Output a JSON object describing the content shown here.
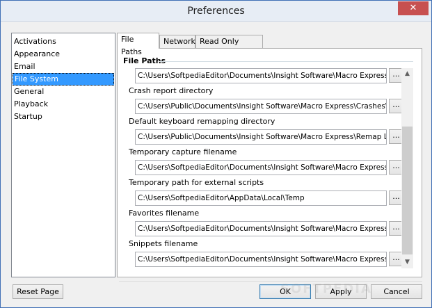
{
  "window": {
    "title": "Preferences",
    "close_glyph": "✕"
  },
  "categories": [
    {
      "label": "Activations",
      "selected": false
    },
    {
      "label": "Appearance",
      "selected": false
    },
    {
      "label": "Email",
      "selected": false
    },
    {
      "label": "File System",
      "selected": true
    },
    {
      "label": "General",
      "selected": false
    },
    {
      "label": "Playback",
      "selected": false
    },
    {
      "label": "Startup",
      "selected": false
    }
  ],
  "tabs": [
    {
      "label": "File Paths",
      "active": true
    },
    {
      "label": "Network",
      "active": false
    },
    {
      "label": "Read Only Prompt",
      "active": false
    }
  ],
  "group": {
    "title": "File Paths"
  },
  "fields": [
    {
      "label": "",
      "value": "C:\\Users\\SoftpediaEditor\\Documents\\Insight Software\\Macro Express\\Mac"
    },
    {
      "label": "Crash report directory",
      "value": "C:\\Users\\Public\\Documents\\Insight Software\\Macro Express\\Crashes\\"
    },
    {
      "label": "Default keyboard remapping directory",
      "value": "C:\\Users\\Public\\Documents\\Insight Software\\Macro Express\\Remap Layou"
    },
    {
      "label": "Temporary capture filename",
      "value": "C:\\Users\\SoftpediaEditor\\Documents\\Insight Software\\Macro Express\\Qui"
    },
    {
      "label": "Temporary path for external scripts",
      "value": "C:\\Users\\SoftpediaEditor\\AppData\\Local\\Temp"
    },
    {
      "label": "Favorites filename",
      "value": "C:\\Users\\SoftpediaEditor\\Documents\\Insight Software\\Macro Express\\Fav"
    },
    {
      "label": "Snippets filename",
      "value": "C:\\Users\\SoftpediaEditor\\Documents\\Insight Software\\Macro Express\\Coc"
    }
  ],
  "browse_label": "...",
  "scrollbar": {
    "up_glyph": "▲",
    "down_glyph": "▼"
  },
  "buttons": {
    "reset_page": "Reset Page",
    "ok": "OK",
    "apply": "Apply",
    "cancel": "Cancel"
  },
  "watermark": "SOFTPEDIA"
}
